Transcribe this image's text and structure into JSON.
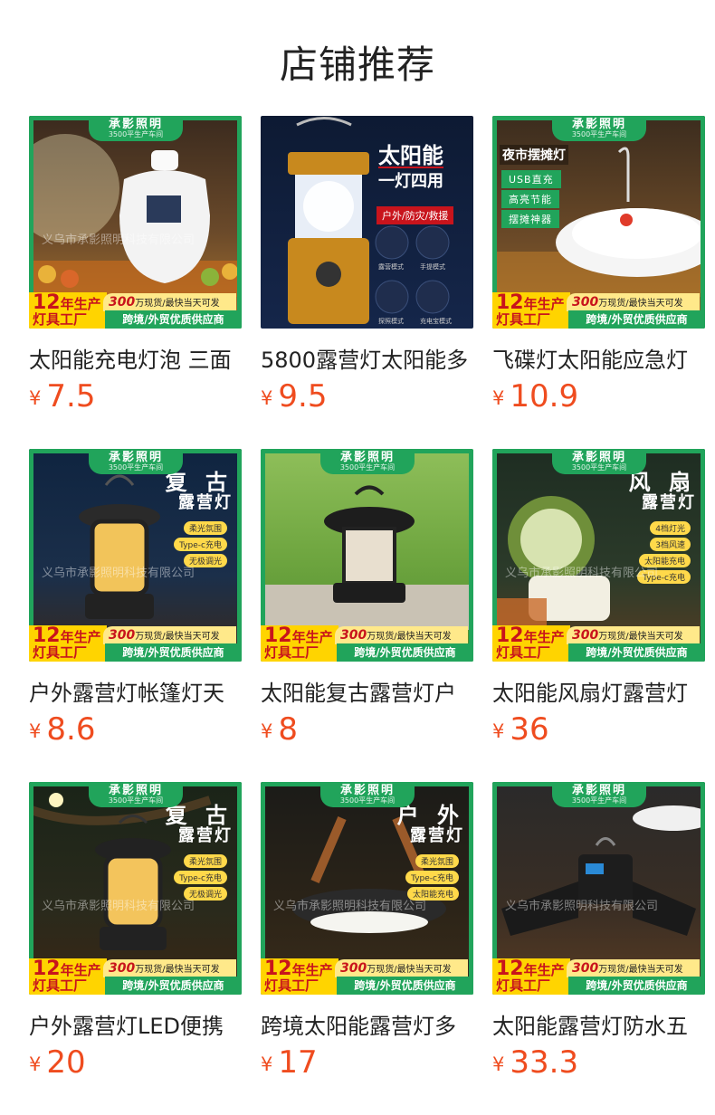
{
  "page": {
    "title": "店铺推荐"
  },
  "badge": {
    "brand": "承影照明",
    "sub": "3500平生产车间"
  },
  "promo": {
    "years_big": "12",
    "years_text": "年生产",
    "factory": "灯具工厂",
    "stock_num": "300",
    "stock_text": "万现货/最快当天可发",
    "band": "跨境/外贸优质供应商"
  },
  "watermark": "义乌市承影照明科技有限公司",
  "currency": "¥",
  "products": [
    {
      "name": "太阳能充电灯泡 三面",
      "price": "7.5"
    },
    {
      "name": "5800露营灯太阳能多",
      "price": "9.5",
      "img_title1": "太阳能",
      "img_title2": "一灯四用",
      "img_tag": "户外/防灾/救援",
      "modes": [
        "露营模式",
        "手提模式",
        "探照模式",
        "充电宝模式"
      ]
    },
    {
      "name": "飞碟灯太阳能应急灯",
      "price": "10.9",
      "img_title": "夜市摆摊灯",
      "img_pills": [
        "USB直充",
        "高亮节能",
        "摆摊神器"
      ]
    },
    {
      "name": "户外露营灯帐篷灯天",
      "price": "8.6",
      "img_title1": "复 古",
      "img_title2": "露营灯",
      "feats": [
        "柔光氛围",
        "Type-c充电",
        "无极调光"
      ]
    },
    {
      "name": "太阳能复古露营灯户",
      "price": "8"
    },
    {
      "name": "太阳能风扇灯露营灯",
      "price": "36",
      "img_title1": "风 扇",
      "img_title2": "露营灯",
      "feats": [
        "4档灯光",
        "3档风速",
        "太阳能充电",
        "Type-c充电"
      ]
    },
    {
      "name": "户外露营灯LED便携",
      "price": "20",
      "img_title1": "复 古",
      "img_title2": "露营灯",
      "feats": [
        "柔光氛围",
        "Type-c充电",
        "无极调光"
      ]
    },
    {
      "name": "跨境太阳能露营灯多",
      "price": "17",
      "img_title1": "户 外",
      "img_title2": "露营灯",
      "feats": [
        "柔光氛围",
        "Type-c充电",
        "太阳能充电"
      ]
    },
    {
      "name": "太阳能露营灯防水五",
      "price": "33.3"
    }
  ],
  "colors": {
    "brand_green": "#21a45b",
    "price": "#ef4c1f",
    "promo_yellow": "#ffd400",
    "promo_red": "#c8141c"
  }
}
